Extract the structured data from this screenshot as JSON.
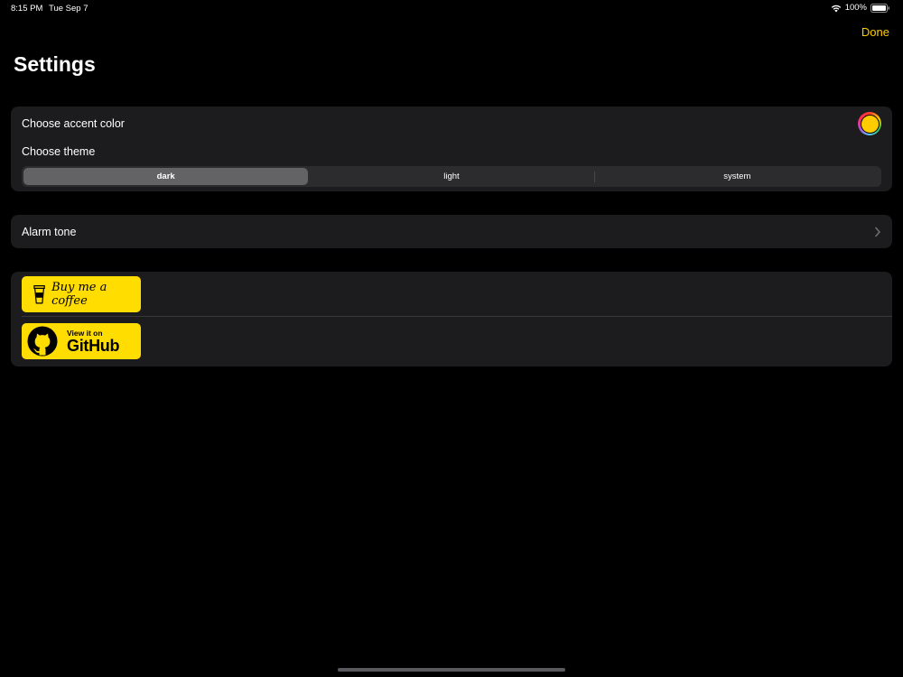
{
  "status_bar": {
    "time": "8:15 PM",
    "date": "Tue Sep 7",
    "battery_percent": "100%",
    "battery_level": 1.0
  },
  "nav": {
    "done_label": "Done",
    "title": "Settings"
  },
  "theme_group": {
    "accent_label": "Choose accent color",
    "accent_color": "#FFCC00",
    "theme_label": "Choose theme",
    "segments": [
      "dark",
      "light",
      "system"
    ],
    "selected_segment": "dark"
  },
  "alarm_group": {
    "label": "Alarm tone"
  },
  "links_group": {
    "coffee_badge": "Buy me a coffee",
    "github_badge_small": "View it on",
    "github_badge_big": "GitHub"
  },
  "colors": {
    "accent": "#FFCC00",
    "badge": "#FFDD00",
    "background": "#000000",
    "group_background": "#1C1C1E"
  },
  "icons": [
    "wifi-icon",
    "battery-icon",
    "chevron-right-icon",
    "coffee-cup-icon",
    "github-icon"
  ]
}
